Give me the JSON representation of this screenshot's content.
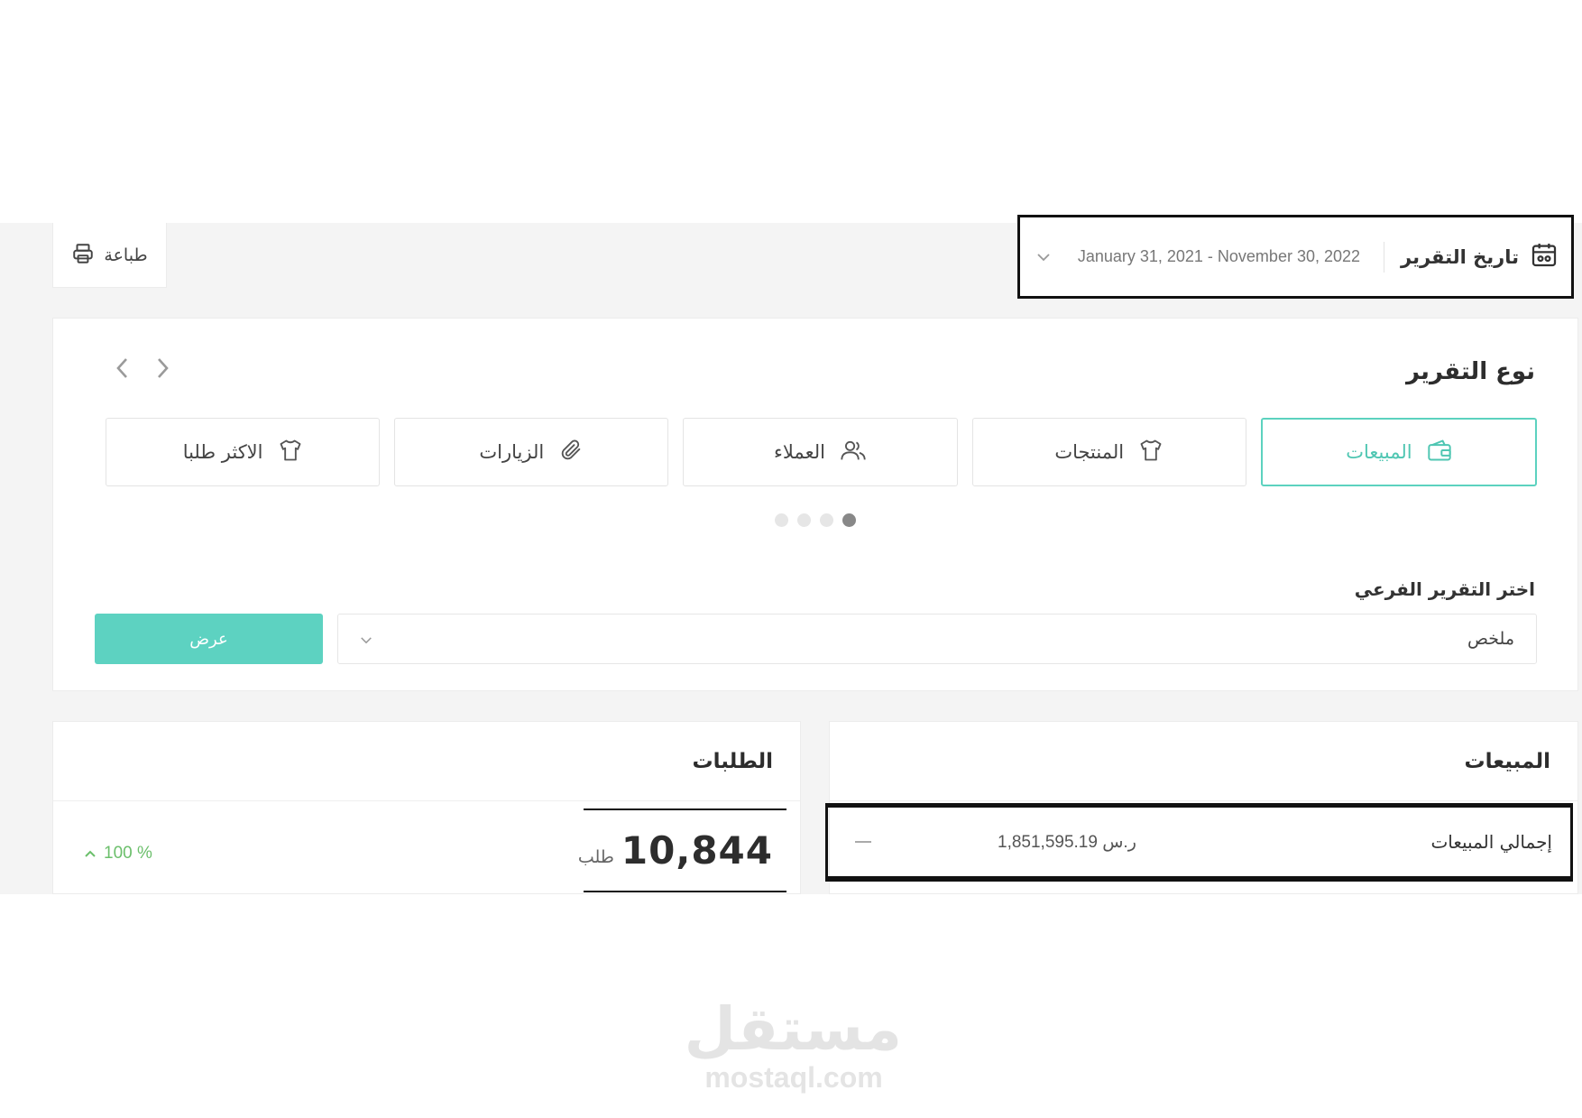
{
  "toolbar": {
    "print_label": "طباعة"
  },
  "date_filter": {
    "title": "تاريخ التقرير",
    "range": "January 31, 2021 - November 30, 2022"
  },
  "report_type": {
    "title": "نوع التقرير",
    "tabs": [
      {
        "label": "المبيعات",
        "icon": "wallet-icon",
        "active": true
      },
      {
        "label": "المنتجات",
        "icon": "tshirt-icon",
        "active": false
      },
      {
        "label": "العملاء",
        "icon": "users-icon",
        "active": false
      },
      {
        "label": "الزيارات",
        "icon": "paperclip-icon",
        "active": false
      },
      {
        "label": "الاكثر طلبا",
        "icon": "tshirt-icon",
        "active": false
      }
    ],
    "page_count": 4,
    "active_page": 1
  },
  "sub_report": {
    "label": "اختر التقرير الفرعي",
    "selected": "ملخص",
    "show_button": "عرض"
  },
  "orders": {
    "title": "الطلبات",
    "value": "10,844",
    "unit": "طلب",
    "change": "100 %"
  },
  "sales": {
    "title": "المبيعات",
    "row_label": "إجمالي المبيعات",
    "row_value": "1,851,595.19 ر.س"
  },
  "watermark": {
    "arabic": "مستقل",
    "latin": "mostaql.com"
  },
  "colors": {
    "accent": "#5dd2c1",
    "positive": "#6bbf6b"
  }
}
